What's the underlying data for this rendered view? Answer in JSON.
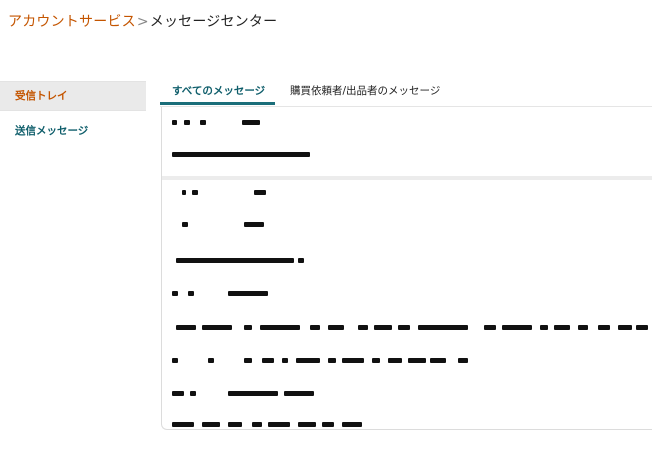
{
  "breadcrumb": {
    "parent": "アカウントサービス",
    "separator": ">",
    "current": "メッセージセンター"
  },
  "sidebar": {
    "items": [
      {
        "label": "受信トレイ",
        "active": true
      },
      {
        "label": "送信メッセージ",
        "active": false
      }
    ]
  },
  "tabs": [
    {
      "label": "すべてのメッセージ",
      "active": true
    },
    {
      "label": "購買依頼者/出品者のメッセージ",
      "active": false
    }
  ],
  "messages": [
    {
      "redacted": true
    },
    {
      "redacted": true
    },
    {
      "redacted": true
    },
    {
      "redacted": true
    },
    {
      "redacted": true
    },
    {
      "redacted": true
    },
    {
      "redacted": true
    },
    {
      "redacted": true
    },
    {
      "redacted": true
    },
    {
      "redacted": true
    }
  ],
  "colors": {
    "link_orange": "#c45500",
    "teal": "#0f5e6b",
    "tab_underline": "#1b6e7a",
    "sidebar_active_bg": "#eaeaea"
  }
}
